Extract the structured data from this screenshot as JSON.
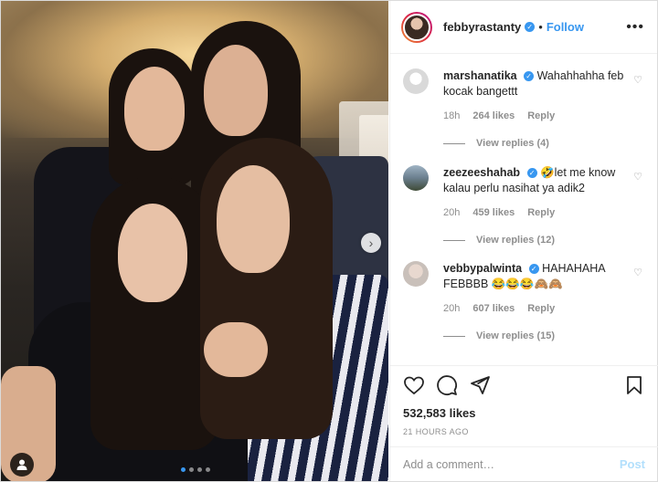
{
  "post": {
    "username": "febbyrastanty",
    "follow_label": "Follow",
    "separator": "•",
    "more_label": "•••",
    "carousel_next": "›",
    "likes": "532,583 likes",
    "timestamp": "21 HOURS AGO"
  },
  "comments": [
    {
      "username": "marshanatika",
      "text": "Wahahhahha feb kocak bangettt",
      "time": "18h",
      "likes": "264 likes",
      "reply": "Reply",
      "view_replies": "View replies (4)"
    },
    {
      "username": "zeezeeshahab",
      "text": "🤣let me know kalau perlu nasihat ya adik2",
      "time": "20h",
      "likes": "459 likes",
      "reply": "Reply",
      "view_replies": "View replies (12)"
    },
    {
      "username": "vebbypalwinta",
      "text": "HAHAHAHA FEBBBB 😂😂😂🙈🙈",
      "time": "20h",
      "likes": "607 likes",
      "reply": "Reply",
      "view_replies": "View replies (15)"
    }
  ],
  "comment_input": {
    "placeholder": "Add a comment…",
    "post_label": "Post"
  },
  "colors": {
    "link_blue": "#3897f0",
    "post_disabled": "#b2dffc",
    "muted": "#8e8e8e"
  },
  "icons": [
    "heart-icon",
    "comment-icon",
    "share-icon",
    "bookmark-icon",
    "verified-icon",
    "tag-user-icon",
    "chevron-right-icon"
  ]
}
